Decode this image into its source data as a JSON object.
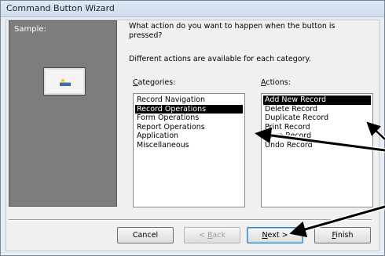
{
  "window": {
    "title": "Command Button Wizard"
  },
  "sample": {
    "label": "Sample:"
  },
  "prompt": {
    "question": "What action do you want to happen when the button is pressed?",
    "hint": "Different actions are available for each category."
  },
  "categories": {
    "label_prefix": "",
    "label_hotkey": "C",
    "label_rest": "ategories:",
    "items": [
      "Record Navigation",
      "Record Operations",
      "Form Operations",
      "Report Operations",
      "Application",
      "Miscellaneous"
    ],
    "selected": "Record Operations"
  },
  "actions": {
    "label_prefix": "",
    "label_hotkey": "A",
    "label_rest": "ctions:",
    "items": [
      "Add New Record",
      "Delete Record",
      "Duplicate Record",
      "Print Record",
      "Save Record",
      "Undo Record"
    ],
    "selected": "Add New Record"
  },
  "buttons": {
    "cancel": "Cancel",
    "back_prefix": "< ",
    "back_hotkey": "B",
    "back_rest": "ack",
    "next_hotkey": "N",
    "next_rest": "ext >",
    "finish_hotkey": "F",
    "finish_rest": "inish"
  }
}
